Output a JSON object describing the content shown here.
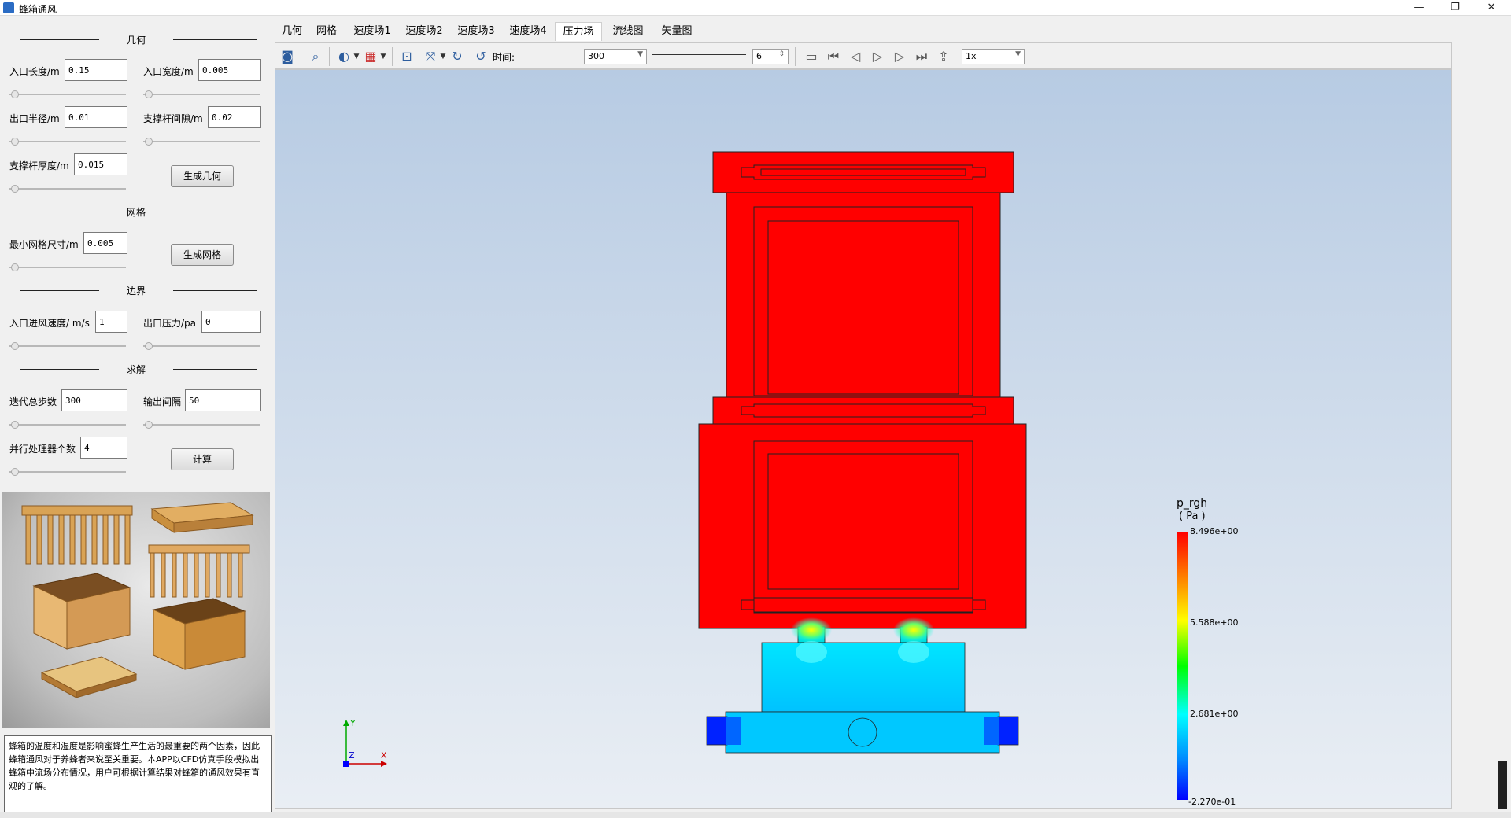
{
  "window": {
    "title": "蜂箱通风",
    "min": "—",
    "max": "❐",
    "close": "✕"
  },
  "left": {
    "sections": {
      "geometry": "几何",
      "mesh": "网格",
      "boundary": "边界",
      "solve": "求解"
    },
    "fields": {
      "inlet_length": {
        "label": "入口长度/m",
        "value": "0.15"
      },
      "inlet_width": {
        "label": "入口宽度/m",
        "value": "0.005"
      },
      "outlet_radius": {
        "label": "出口半径/m",
        "value": "0.01"
      },
      "rod_gap": {
        "label": "支撑杆间隙/m",
        "value": "0.02"
      },
      "rod_thickness": {
        "label": "支撑杆厚度/m",
        "value": "0.015"
      },
      "min_mesh": {
        "label": "最小网格尺寸/m",
        "value": "0.005"
      },
      "inlet_speed": {
        "label": "入口进风速度/ m/s",
        "value": "1"
      },
      "outlet_pressure": {
        "label": "出口压力/pa",
        "value": "0"
      },
      "iterations": {
        "label": "迭代总步数",
        "value": "300"
      },
      "output_interval": {
        "label": "输出间隔",
        "value": "50"
      },
      "processors": {
        "label": "并行处理器个数",
        "value": "4"
      }
    },
    "buttons": {
      "gen_geometry": "生成几何",
      "gen_mesh": "生成网格",
      "compute": "计算"
    },
    "description": "蜂箱的温度和湿度是影响蜜蜂生产生活的最重要的两个因素，因此蜂箱通风对于养蜂者来说至关重要。本APP以CFD仿真手段模拟出蜂箱中流场分布情况，用户可根据计算结果对蜂箱的通风效果有直观的了解。"
  },
  "tabs": [
    "几何",
    "网格",
    "速度场1",
    "速度场2",
    "速度场3",
    "速度场4",
    "压力场",
    "流线图",
    "矢量图"
  ],
  "active_tab": "压力场",
  "toolbar": {
    "time_label": "时间:",
    "time_value": "300",
    "frame_value": "6",
    "speed_value": "1x",
    "icons": [
      "camera-icon",
      "zoom-icon",
      "display-mode-icon",
      "colormap-icon",
      "fit-view-icon",
      "axes-icon",
      "rotate-cw-icon",
      "rotate-ccw-icon",
      "record-icon",
      "first-frame-icon",
      "prev-frame-icon",
      "play-icon",
      "next-frame-icon",
      "last-frame-icon",
      "loop-icon"
    ]
  },
  "legend": {
    "title": "p_rgh",
    "unit": "( Pa )",
    "ticks": [
      "8.496e+00",
      "5.588e+00",
      "2.681e+00",
      "-2.270e-01"
    ]
  },
  "axes": {
    "y": "Y",
    "z": "Z",
    "x": "X"
  },
  "colors": {
    "high": "#ff0000",
    "low": "#0000ff",
    "cyan": "#00e5ff"
  }
}
